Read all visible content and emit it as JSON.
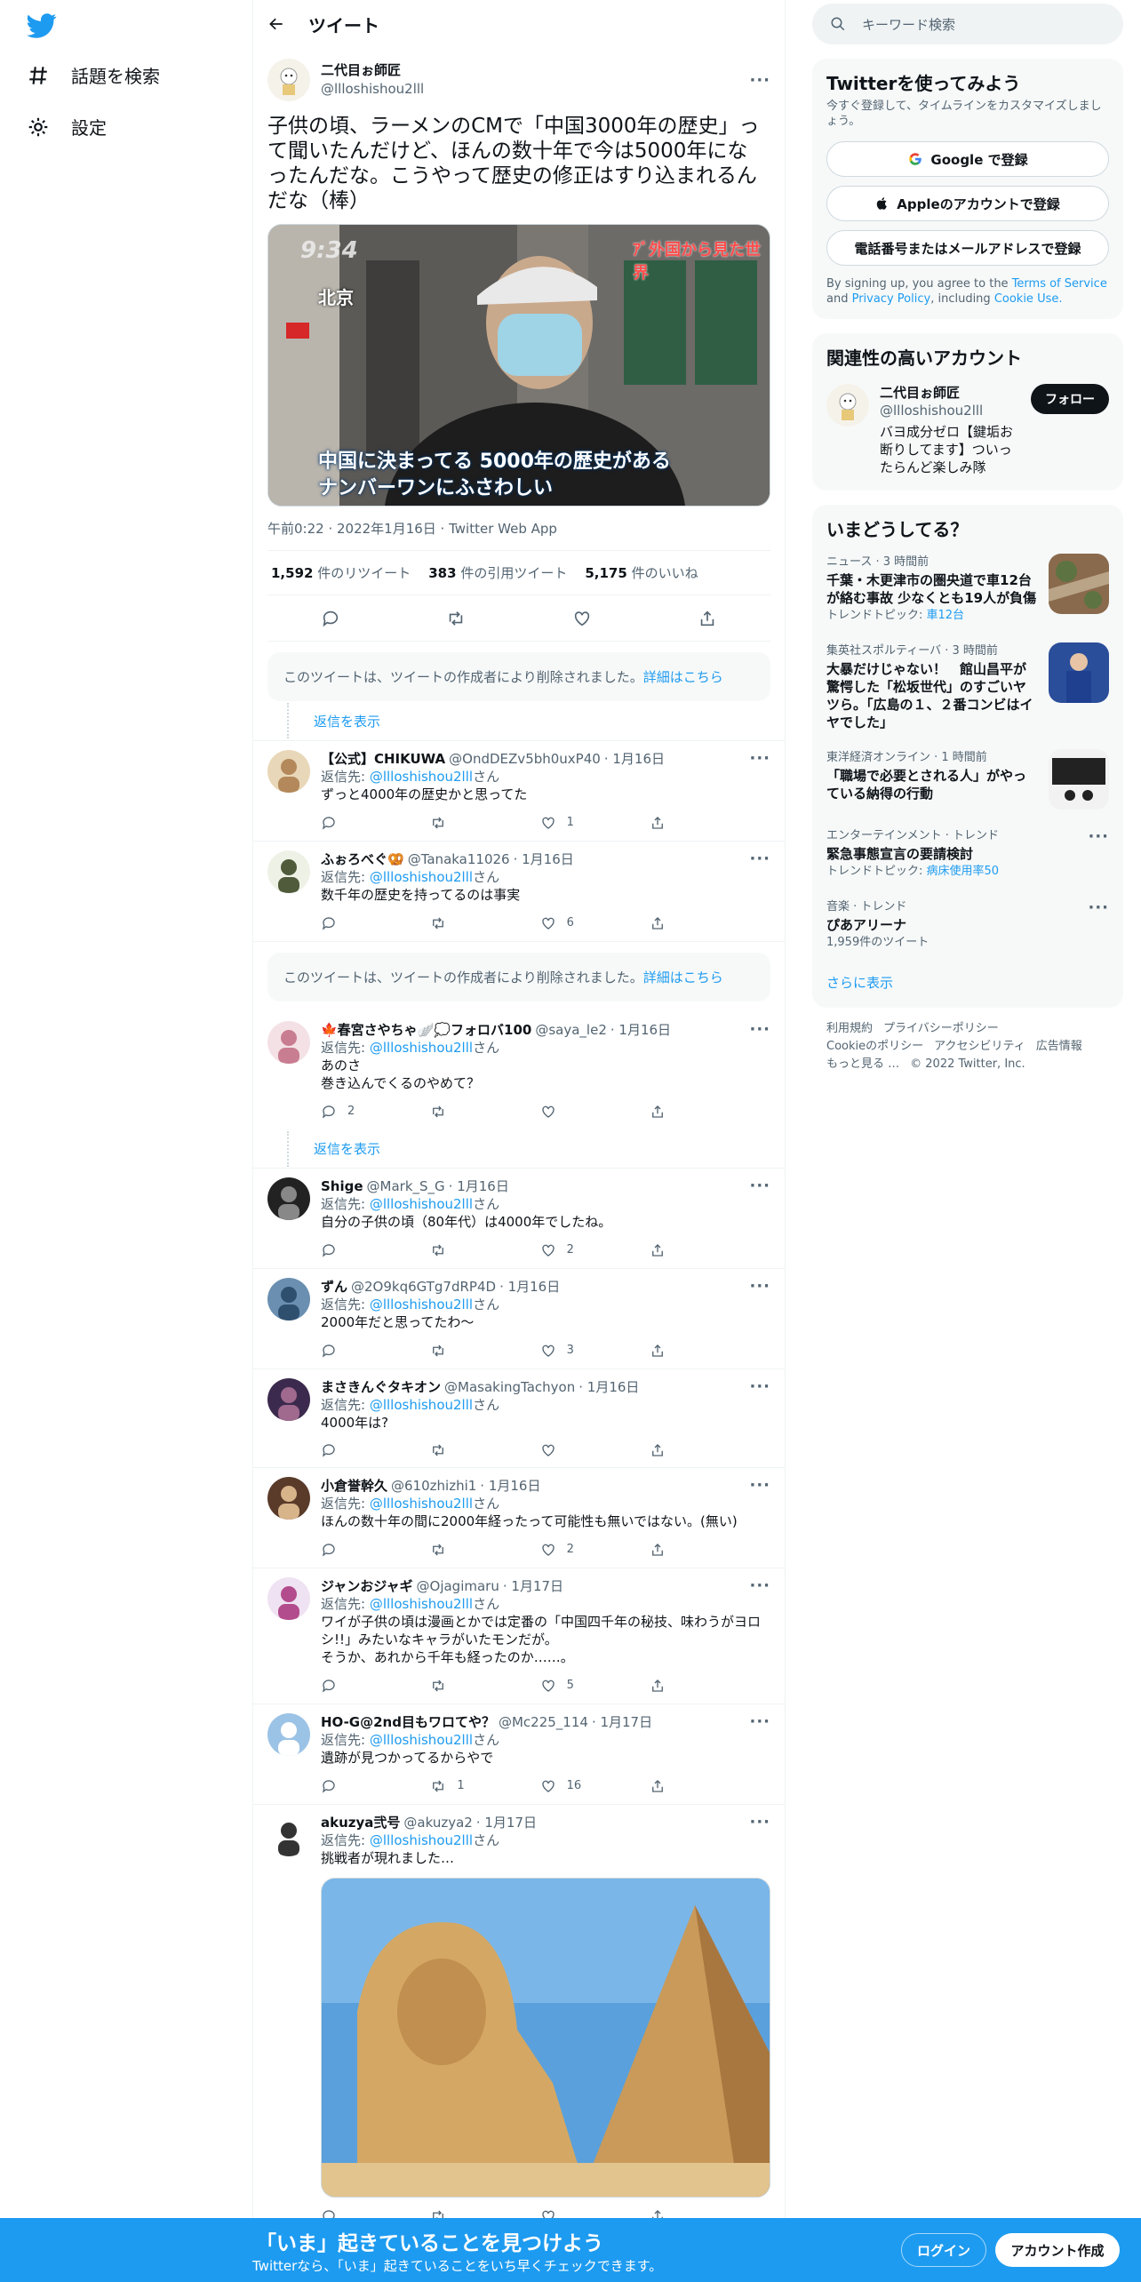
{
  "nav": {
    "explore_label": "話題を検索",
    "settings_label": "設定"
  },
  "header": {
    "title": "ツイート"
  },
  "main_tweet": {
    "name": "二代目ぉ師匠",
    "handle": "@llloshishou2lll",
    "text": "子供の頃、ラーメンのCMで「中国3000年の歴史」って聞いたんだけど、ほんの数十年で今は5000年になったんだな。こうやって歴史の修正はすり込まれるんだな（棒）",
    "media": {
      "time_overlay": "9:34",
      "location_overlay": "北京",
      "logo_overlay": "ｱﾞ外国から見た世界",
      "caption_line1": "中国に決まってる 5000年の歴史がある",
      "caption_line2": "ナンバーワンにふさわしい"
    },
    "meta": "午前0:22 · 2022年1月16日 · Twitter Web App",
    "retweets_count": "1,592",
    "retweets_label": "件のリツイート",
    "quotes_count": "383",
    "quotes_label": "件の引用ツイート",
    "likes_count": "5,175",
    "likes_label": "件のいいね"
  },
  "deleted_notice": {
    "text": "このツイートは、ツイートの作成者により削除されました。",
    "link": "詳細はこちら"
  },
  "show_replies_label": "返信を表示",
  "reply_to_prefix": "返信先: ",
  "reply_to_handle": "@llloshishou2lll",
  "reply_to_suffix": "さん",
  "replies": [
    {
      "name": "【公式】CHIKUWA",
      "handle": "@OndDEZv5bh0uxP40",
      "date": "· 1月16日",
      "text": "ずっと4000年の歴史かと思ってた",
      "replies": "",
      "retweets": "",
      "likes": "1"
    },
    {
      "name": "ふぉろべぐ🥨",
      "handle": "@Tanaka11026",
      "date": "· 1月16日",
      "text": "数千年の歴史を持ってるのは事実",
      "replies": "",
      "retweets": "",
      "likes": "6"
    },
    {
      "name": "🍁春宮さやちゃ🪽💭フォロバ100",
      "handle": "@saya_le2",
      "date": "· 1月16日",
      "text": "あのさ\n巻き込んでくるのやめて？",
      "replies": "2",
      "retweets": "",
      "likes": ""
    },
    {
      "name": "Shige",
      "handle": "@Mark_S_G",
      "date": "· 1月16日",
      "text": "自分の子供の頃（80年代）は4000年でしたね。",
      "replies": "",
      "retweets": "",
      "likes": "2"
    },
    {
      "name": "ずん",
      "handle": "@2O9kq6GTg7dRP4D",
      "date": "· 1月16日",
      "text": "2000年だと思ってたわ〜",
      "replies": "",
      "retweets": "",
      "likes": "3"
    },
    {
      "name": "まさきんぐタキオン",
      "handle": "@MasakingTachyon",
      "date": "· 1月16日",
      "text": "4000年は?",
      "replies": "",
      "retweets": "",
      "likes": ""
    },
    {
      "name": "小倉誉幹久",
      "handle": "@610zhizhi1",
      "date": "· 1月16日",
      "text": "ほんの数十年の間に2000年経ったって可能性も無いではない。(無い)",
      "replies": "",
      "retweets": "",
      "likes": "2"
    },
    {
      "name": "ジャンおジャギ",
      "handle": "@Ojagimaru",
      "date": "· 1月17日",
      "text": "ワイが子供の頃は漫画とかでは定番の「中国四千年の秘技、味わうがヨロシ!!」みたいなキャラがいたモンだが。\nそうか、あれから千年も経ったのか……。",
      "replies": "",
      "retweets": "",
      "likes": "5"
    },
    {
      "name": "HO-G@2nd目もワロてや？",
      "handle": "@Mc225_114",
      "date": "· 1月17日",
      "text": "遺跡が見つかってるからやで",
      "replies": "",
      "retweets": "1",
      "likes": "16"
    },
    {
      "name": "akuzya弐号",
      "handle": "@akuzya2",
      "date": "· 1月17日",
      "text": "挑戦者が現れました…",
      "replies": "",
      "retweets": "",
      "likes": ""
    }
  ],
  "right": {
    "search_placeholder": "キーワード検索",
    "signup_title": "Twitterを使ってみよう",
    "signup_sub": "今すぐ登録して、タイムラインをカスタマイズしましょう。",
    "google_btn": "Google で登録",
    "apple_btn": "Appleのアカウントで登録",
    "phone_btn": "電話番号またはメールアドレスで登録",
    "terms_prefix": "By signing up, you agree to the ",
    "terms_link": "Terms of Service",
    "terms_and": " and ",
    "privacy_link": "Privacy Policy",
    "terms_including": ", including ",
    "cookie_link": "Cookie Use.",
    "related_title": "関連性の高いアカウント",
    "related_name": "二代目ぉ師匠",
    "related_handle": "@llloshishou2lll",
    "related_bio": "バヨ成分ゼロ【鍵垢お断りしてます】ついったらんど楽しみ隊",
    "follow_label": "フォロー",
    "trends_title": "いまどうしてる？",
    "trends": [
      {
        "ctx": "ニュース · 3 時間前",
        "title": "千葉・木更津市の圏央道で車12台が絡む事故 少なくとも19人が負傷",
        "sub_prefix": "トレンドトピック: ",
        "sub_link": "車12台"
      },
      {
        "ctx": "集英社スポルティーバ · 3 時間前",
        "title": "大暴だけじゃない！　館山昌平が驚愕した「松坂世代」のすごいヤツら。「広島の１、２番コンビはイヤでした」",
        "sub_prefix": "",
        "sub_link": ""
      },
      {
        "ctx": "東洋経済オンライン · 1 時間前",
        "title": "「職場で必要とされる人」がやっている納得の行動",
        "sub_prefix": "",
        "sub_link": ""
      },
      {
        "ctx": "エンターテインメント · トレンド",
        "title": "緊急事態宣言の要請検討",
        "sub_prefix": "トレンドトピック: ",
        "sub_link": "病床使用率50"
      },
      {
        "ctx": "音楽 · トレンド",
        "title": "ぴあアリーナ",
        "sub_prefix": "1,959件のツイート",
        "sub_link": ""
      }
    ],
    "show_more": "さらに表示",
    "footer": [
      "利用規約",
      "プライバシーポリシー",
      "Cookieのポリシー",
      "アクセシビリティ",
      "広告情報",
      "もっと見る …",
      "© 2022 Twitter, Inc."
    ]
  },
  "bottom_bar": {
    "title": "「いま」起きていることを見つけよう",
    "sub": "Twitterなら、「いま」起きていることをいち早くチェックできます。",
    "login": "ログイン",
    "signup": "アカウント作成"
  }
}
